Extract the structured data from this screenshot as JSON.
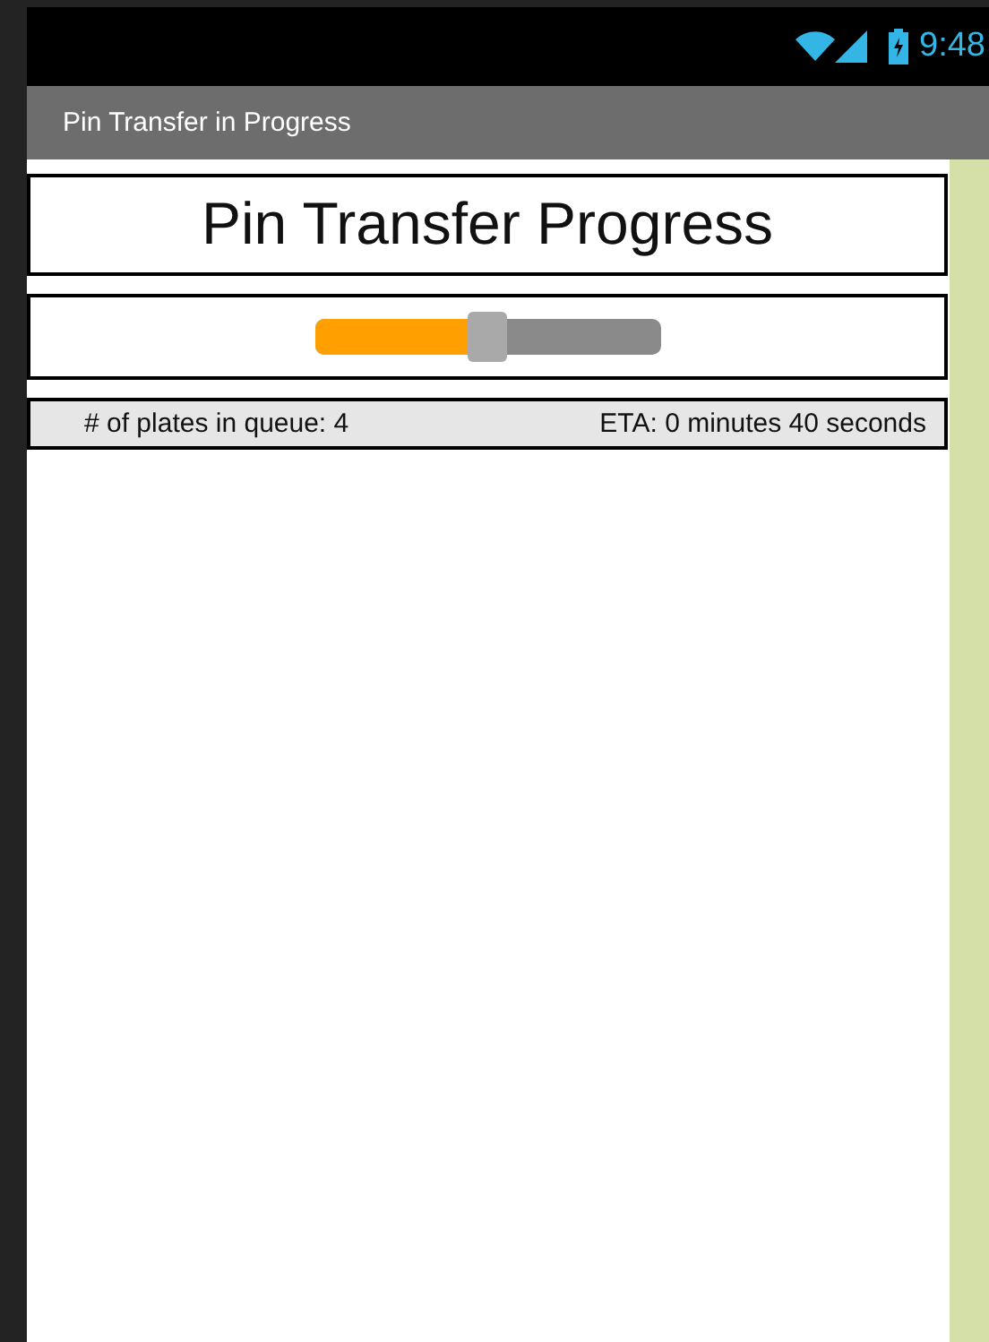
{
  "status_bar": {
    "time": "9:48"
  },
  "app_bar": {
    "title": "Pin Transfer in Progress"
  },
  "heading": "Pin Transfer Progress",
  "progress_slider": {
    "level": 0.5
  },
  "info": {
    "queue": "# of plates in queue: 4",
    "eta": "ETA: 0 minutes 40 seconds"
  }
}
